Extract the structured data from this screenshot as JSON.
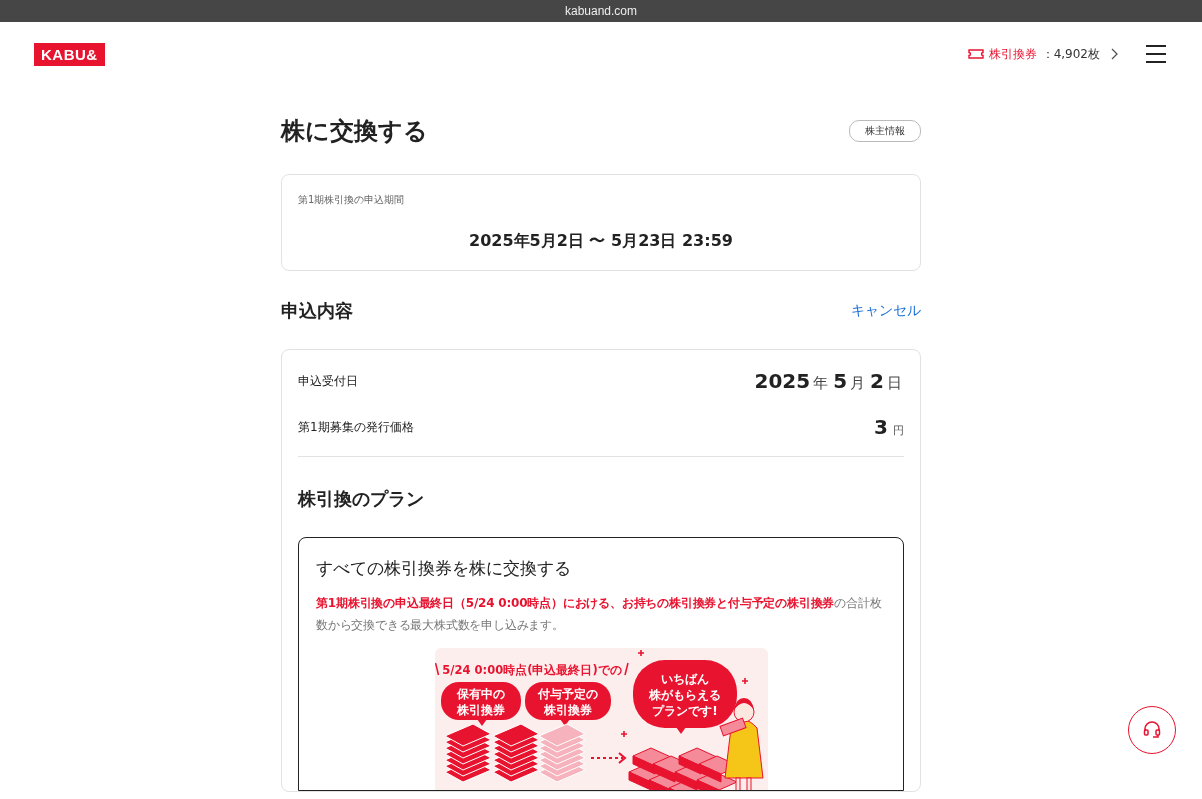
{
  "browser": {
    "address": "kabuand.com"
  },
  "header": {
    "logo": "KABU&",
    "tickets": {
      "label": "株引換券",
      "value": "：4,902枚"
    }
  },
  "page": {
    "title": "株に交換する",
    "shareholder_button": "株主情報"
  },
  "period": {
    "label": "第1期株引換の申込期間",
    "value": "2025年5月2日 〜 5月23日 23:59"
  },
  "application": {
    "heading": "申込内容",
    "cancel": "キャンセル",
    "rows": [
      {
        "label": "申込受付日",
        "parts": [
          {
            "text": "2025",
            "kind": "number"
          },
          {
            "text": "年",
            "kind": "unit"
          },
          {
            "text": "5",
            "kind": "number"
          },
          {
            "text": "月",
            "kind": "unit"
          },
          {
            "text": "2",
            "kind": "number"
          },
          {
            "text": "日",
            "kind": "unit"
          }
        ]
      },
      {
        "label": "第1期募集の発行価格",
        "parts": [
          {
            "text": "3",
            "kind": "number"
          },
          {
            "text": "円",
            "kind": "small-unit"
          }
        ]
      }
    ]
  },
  "plan": {
    "heading": "株引換のプラン",
    "card": {
      "title": "すべての株引換券を株に交換する",
      "description": "**第1期株引換の申込最終日（5/24 0:00時点）における、お持ちの株引換券と付与予定の株引換券**の合計枚数から交換できる最大株式数を申し込みます。",
      "illustration": {
        "caption": "5/24 0:00時点(申込最終日)での",
        "bubbles": [
          {
            "lines": [
              "保有中の",
              "株引換券"
            ]
          },
          {
            "lines": [
              "付与予定の",
              "株引換券"
            ]
          },
          {
            "lines": [
              "いちばん",
              "株がもらえる",
              "プランです!"
            ]
          }
        ]
      }
    }
  }
}
